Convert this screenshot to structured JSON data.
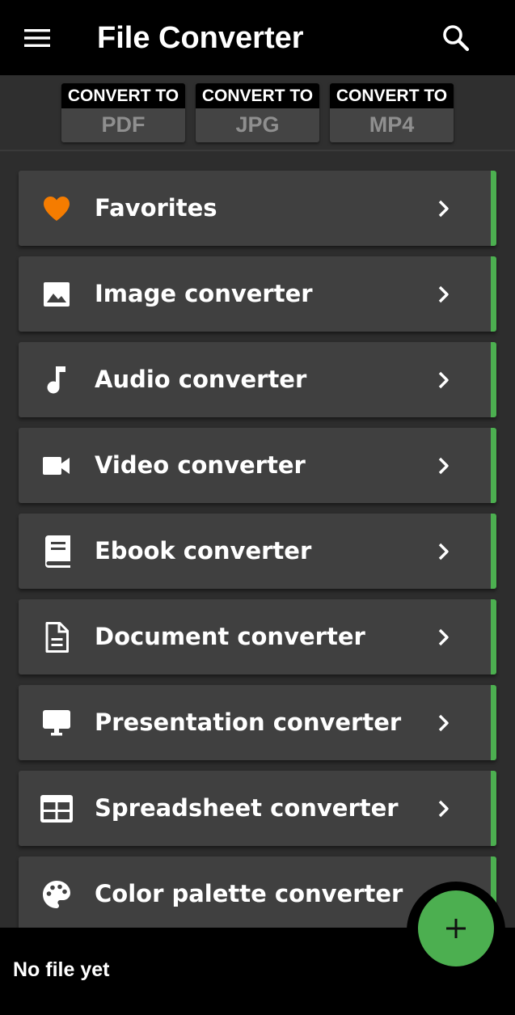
{
  "appbar": {
    "title": "File Converter",
    "menu_icon": "menu-icon",
    "search_icon": "search-icon"
  },
  "quick_convert": [
    {
      "prefix": "CONVERT TO",
      "format": "PDF"
    },
    {
      "prefix": "CONVERT TO",
      "format": "JPG"
    },
    {
      "prefix": "CONVERT TO",
      "format": "MP4"
    }
  ],
  "categories": [
    {
      "label": "Favorites",
      "icon": "heart-icon"
    },
    {
      "label": "Image converter",
      "icon": "image-icon"
    },
    {
      "label": "Audio converter",
      "icon": "music-note-icon"
    },
    {
      "label": "Video converter",
      "icon": "video-camera-icon"
    },
    {
      "label": "Ebook converter",
      "icon": "book-icon"
    },
    {
      "label": "Document converter",
      "icon": "document-icon"
    },
    {
      "label": "Presentation converter",
      "icon": "presentation-icon"
    },
    {
      "label": "Spreadsheet converter",
      "icon": "spreadsheet-icon"
    },
    {
      "label": "Color palette converter",
      "icon": "palette-icon"
    }
  ],
  "bottom": {
    "status": "No file yet",
    "fab_icon": "plus-icon"
  },
  "colors": {
    "accent": "#4caf50",
    "favorite": "#f57c00",
    "card": "#404040",
    "background": "#2d2d2d",
    "bar": "#000000"
  }
}
